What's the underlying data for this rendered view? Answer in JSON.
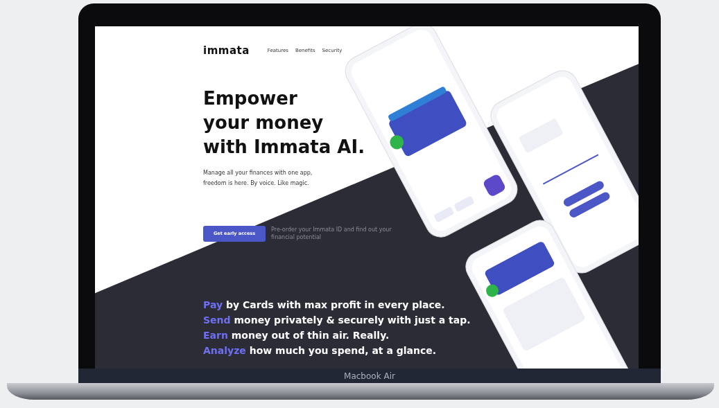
{
  "site": {
    "logo": "immata",
    "nav": [
      {
        "label": "Features"
      },
      {
        "label": "Benefits"
      },
      {
        "label": "Security"
      }
    ]
  },
  "hero": {
    "title_lines": [
      "Empower",
      "your money",
      "with Immata AI."
    ],
    "subtitle_lines": [
      "Manage all your finances with one app,",
      "freedom is here. By voice. Like magic."
    ]
  },
  "cta": {
    "label": "Get early access",
    "note_lines": [
      "Pre-order your Immata ID and find out your",
      "financial potential"
    ]
  },
  "features": [
    {
      "verb": "Pay",
      "rest": "by Cards with max profit in every place."
    },
    {
      "verb": "Send",
      "rest": "money privately & securely with just a tap."
    },
    {
      "verb": "Earn",
      "rest": "money out of thin air. Really."
    },
    {
      "verb": "Analyze",
      "rest": "how much you spend, at a glance."
    }
  ],
  "device_label": "Macbook Air"
}
